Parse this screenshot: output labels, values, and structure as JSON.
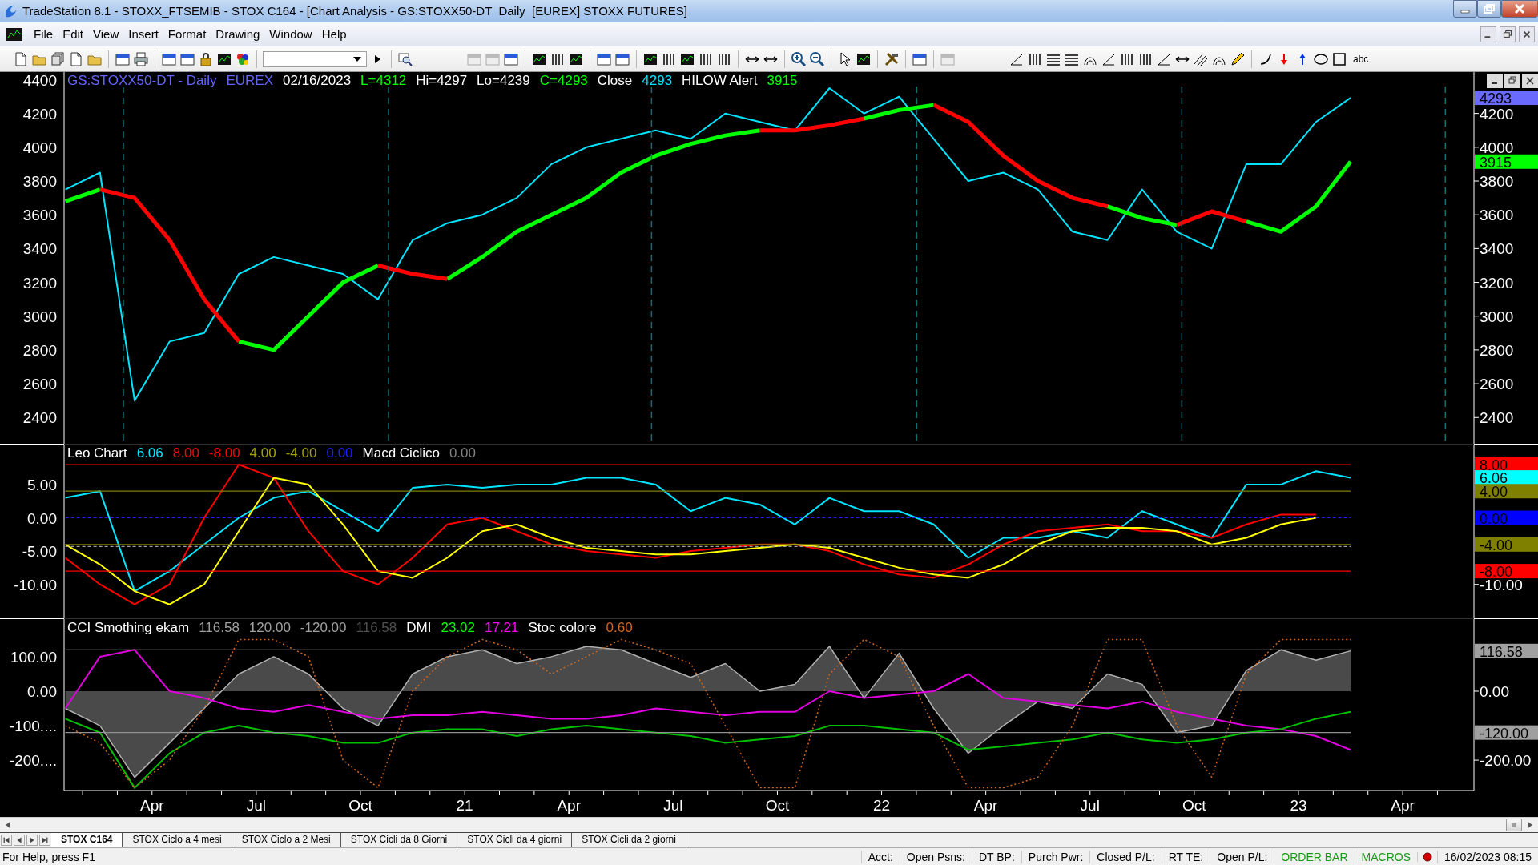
{
  "window": {
    "title": "TradeStation 8.1 - STOXX_FTSEMIB - STOX C164 - [Chart Analysis - GS:STOXX50-DT  Daily  [EUREX] STOXX FUTURES]"
  },
  "menu": [
    "File",
    "Edit",
    "View",
    "Insert",
    "Format",
    "Drawing",
    "Window",
    "Help"
  ],
  "toolbar": {
    "text_tool": "abc"
  },
  "panels": [
    {
      "legend": [
        {
          "text": "GS:STOXX50-DT - Daily",
          "color": "#6464ff"
        },
        {
          "text": "EUREX",
          "color": "#6464ff"
        },
        {
          "text": "02/16/2023",
          "color": "#ffffff"
        },
        {
          "text": "L=4312",
          "color": "#00ff00"
        },
        {
          "text": "Hi=4297",
          "color": "#ffffff"
        },
        {
          "text": "Lo=4239",
          "color": "#ffffff"
        },
        {
          "text": "C=4293",
          "color": "#00ff00"
        },
        {
          "text": "Close",
          "color": "#ffffff"
        },
        {
          "text": "4293",
          "color": "#00e5ff"
        },
        {
          "text": "HILOW Alert",
          "color": "#ffffff"
        },
        {
          "text": "3915",
          "color": "#00ff00"
        }
      ],
      "right_axis_labels": [
        "4200",
        "4000",
        "3800",
        "3600",
        "3400",
        "3200",
        "3000",
        "2800",
        "2600",
        "2400"
      ],
      "value_markers": [
        {
          "text": "4293",
          "color": "#6a6aff"
        },
        {
          "text": "3915",
          "color": "#00ff00"
        }
      ],
      "chart_data": {
        "type": "line",
        "x": [
          20.042,
          20.125,
          20.208,
          20.292,
          20.375,
          20.458,
          20.542,
          20.625,
          20.708,
          20.792,
          20.875,
          20.958,
          21.042,
          21.125,
          21.208,
          21.292,
          21.375,
          21.458,
          21.542,
          21.625,
          21.708,
          21.792,
          21.875,
          21.958,
          22.042,
          22.125,
          22.208,
          22.292,
          22.375,
          22.458,
          22.542,
          22.625,
          22.708,
          22.792,
          22.875,
          22.958,
          23.042,
          23.125
        ],
        "xlim": [
          20.039,
          23.417
        ],
        "ylim": [
          2240,
          4445
        ],
        "yticks": [
          {
            "value": 4400,
            "label": "4400"
          },
          {
            "value": 4200,
            "label": "4200"
          },
          {
            "value": 4000,
            "label": "4000"
          },
          {
            "value": 3800,
            "label": "3800"
          },
          {
            "value": 3600,
            "label": "3600"
          },
          {
            "value": 3400,
            "label": "3400"
          },
          {
            "value": 3200,
            "label": "3200"
          },
          {
            "value": 3000,
            "label": "3000"
          },
          {
            "value": 2800,
            "label": "2800"
          },
          {
            "value": 2600,
            "label": "2600"
          },
          {
            "value": 2400,
            "label": "2400"
          }
        ],
        "series": [
          {
            "color": "#00e5ff",
            "values": [
              3750,
              3850,
              2500,
              2850,
              2900,
              3250,
              3350,
              3300,
              3250,
              3100,
              3450,
              3550,
              3600,
              3700,
              3900,
              4000,
              4050,
              4100,
              4050,
              4200,
              4150,
              4100,
              4350,
              4200,
              4300,
              4050,
              3800,
              3850,
              3750,
              3500,
              3450,
              3750,
              3500,
              3400,
              3900,
              3900,
              4150,
              4293
            ]
          },
          {
            "color": "#00ff00",
            "values": [
              3680,
              3750,
              null,
              null,
              null,
              2850,
              2800,
              3000,
              3200,
              3300,
              null,
              3220,
              3350,
              3500,
              3600,
              3700,
              3850,
              3950,
              4020,
              4070,
              4100,
              null,
              null,
              4170,
              4220,
              4250,
              null,
              null,
              null,
              null,
              3650,
              3580,
              3540,
              null,
              3560,
              3500,
              3650,
              3915
            ]
          },
          {
            "color": "#ff0000",
            "values": [
              null,
              3750,
              3700,
              3450,
              3100,
              2850,
              null,
              null,
              null,
              3300,
              3250,
              3220,
              null,
              null,
              null,
              null,
              null,
              null,
              null,
              null,
              4100,
              4100,
              4130,
              4170,
              null,
              4250,
              4150,
              3950,
              3800,
              3700,
              3650,
              null,
              3540,
              3620,
              3560,
              null,
              null,
              null
            ]
          }
        ]
      }
    },
    {
      "legend": [
        {
          "text": "Leo Chart",
          "color": "#ffffff"
        },
        {
          "text": "6.06",
          "color": "#00e5ff"
        },
        {
          "text": "8.00",
          "color": "#ff0000"
        },
        {
          "text": "-8.00",
          "color": "#ff0000"
        },
        {
          "text": "4.00",
          "color": "#a0a000"
        },
        {
          "text": "-4.00",
          "color": "#a0a000"
        },
        {
          "text": "0.00",
          "color": "#2020ff"
        },
        {
          "text": "Macd Ciclico",
          "color": "#ffffff"
        },
        {
          "text": "0.00",
          "color": "#808080"
        }
      ],
      "right_axis_labels": [
        "-10.00"
      ],
      "value_markers": [
        {
          "text": "8.00",
          "color": "#ff0000"
        },
        {
          "text": "6.06",
          "color": "#00ffff"
        },
        {
          "text": "4.00",
          "color": "#808000"
        },
        {
          "text": "0.00",
          "color": "#0000ff"
        },
        {
          "text": "-4.00",
          "color": "#808000"
        },
        {
          "text": "-8.00",
          "color": "#ff0000"
        }
      ],
      "chart_data": {
        "type": "line",
        "x": [
          20.042,
          20.125,
          20.208,
          20.292,
          20.375,
          20.458,
          20.542,
          20.625,
          20.708,
          20.792,
          20.875,
          20.958,
          21.042,
          21.125,
          21.208,
          21.292,
          21.375,
          21.458,
          21.542,
          21.625,
          21.708,
          21.792,
          21.875,
          21.958,
          22.042,
          22.125,
          22.208,
          22.292,
          22.375,
          22.458,
          22.542,
          22.625,
          22.708,
          22.792,
          22.875,
          22.958,
          23.042,
          23.125
        ],
        "xlim": [
          20.039,
          23.417
        ],
        "ylim": [
          -15.2,
          11
        ],
        "yticks": [
          {
            "value": 5,
            "label": "5.00"
          },
          {
            "value": 0,
            "label": "0.00"
          },
          {
            "value": -5,
            "label": "-5.00"
          },
          {
            "value": -10,
            "label": "-10.00"
          }
        ],
        "series": [
          {
            "color": "#00e5ff",
            "values": [
              3,
              4,
              -11,
              -8,
              -4,
              0,
              3,
              4,
              1,
              -2,
              4.5,
              5,
              4.5,
              5,
              5,
              6,
              6,
              5,
              1,
              3,
              2,
              -1,
              3,
              1,
              1,
              -1,
              -6,
              -3,
              -3,
              -2,
              -3,
              1,
              -1,
              -3,
              5,
              5,
              7,
              6
            ]
          },
          {
            "color": "#ff0000",
            "values": [
              -6,
              -10,
              -13,
              -10,
              0,
              8,
              6,
              -2,
              -8,
              -10,
              -6,
              -1,
              0,
              -2,
              -4,
              -5,
              -5.5,
              -6,
              -5,
              -4.5,
              -4,
              -4,
              -5,
              -7,
              -8.5,
              -9,
              -7,
              -4,
              -2,
              -1.5,
              -1,
              -2,
              -2,
              -3,
              -1,
              0.5,
              0.5,
              null
            ]
          },
          {
            "color": "#ffff00",
            "values": [
              -4,
              -7,
              -11,
              -13,
              -10,
              -2,
              6,
              5,
              -1,
              -8,
              -9,
              -6,
              -2,
              -1,
              -3,
              -4.5,
              -5,
              -5.5,
              -5.5,
              -5,
              -4.5,
              -4,
              -4.5,
              -6,
              -7.5,
              -8.5,
              -9,
              -7,
              -4,
              -2,
              -1.5,
              -1.5,
              -2,
              -4,
              -3,
              -1,
              0,
              null
            ]
          },
          {
            "color": "#ff0000",
            "values": [
              8,
              8,
              8,
              8,
              8,
              8,
              8,
              8,
              8,
              8,
              8,
              8,
              8,
              8,
              8,
              8,
              8,
              8,
              8,
              8,
              8,
              8,
              8,
              8,
              8,
              8,
              8,
              8,
              8,
              8,
              8,
              8,
              8,
              8,
              8,
              8,
              8,
              8
            ]
          },
          {
            "color": "#ff0000",
            "values": [
              -8,
              -8,
              -8,
              -8,
              -8,
              -8,
              -8,
              -8,
              -8,
              -8,
              -8,
              -8,
              -8,
              -8,
              -8,
              -8,
              -8,
              -8,
              -8,
              -8,
              -8,
              -8,
              -8,
              -8,
              -8,
              -8,
              -8,
              -8,
              -8,
              -8,
              -8,
              -8,
              -8,
              -8,
              -8,
              -8,
              -8,
              -8
            ]
          },
          {
            "color": "#808000",
            "values": [
              4,
              4,
              4,
              4,
              4,
              4,
              4,
              4,
              4,
              4,
              4,
              4,
              4,
              4,
              4,
              4,
              4,
              4,
              4,
              4,
              4,
              4,
              4,
              4,
              4,
              4,
              4,
              4,
              4,
              4,
              4,
              4,
              4,
              4,
              4,
              4,
              4,
              4
            ]
          },
          {
            "color": "#808000",
            "values": [
              -4,
              -4,
              -4,
              -4,
              -4,
              -4,
              -4,
              -4,
              -4,
              -4,
              -4,
              -4,
              -4,
              -4,
              -4,
              -4,
              -4,
              -4,
              -4,
              -4,
              -4,
              -4,
              -4,
              -4,
              -4,
              -4,
              -4,
              -4,
              -4,
              -4,
              -4,
              -4,
              -4,
              -4,
              -4,
              -4,
              -4,
              -4
            ]
          },
          {
            "color": "#2020ff",
            "line_style": "dashed",
            "values": [
              0,
              0,
              0,
              0,
              0,
              0,
              0,
              0,
              0,
              0,
              0,
              0,
              0,
              0,
              0,
              0,
              0,
              0,
              0,
              0,
              0,
              0,
              0,
              0,
              0,
              0,
              0,
              0,
              0,
              0,
              0,
              0,
              0,
              0,
              0,
              0,
              0,
              0
            ]
          },
          {
            "color": "#a0a0a0",
            "line_style": "dashed",
            "values": [
              -4.3,
              -4.3,
              -4.3,
              -4.3,
              -4.3,
              -4.3,
              -4.3,
              -4.3,
              -4.3,
              -4.3,
              -4.3,
              -4.3,
              -4.3,
              -4.3,
              -4.3,
              -4.3,
              -4.3,
              -4.3,
              -4.3,
              -4.3,
              -4.3,
              -4.3,
              -4.3,
              -4.3,
              -4.3,
              -4.3,
              -4.3,
              -4.3,
              -4.3,
              -4.3,
              -4.3,
              -4.3,
              -4.3,
              -4.3,
              -4.3,
              -4.3,
              -4.3,
              -4.3
            ]
          }
        ]
      }
    },
    {
      "legend": [
        {
          "text": "CCI Smothing ekam",
          "color": "#ffffff"
        },
        {
          "text": "116.58",
          "color": "#a0a0a0"
        },
        {
          "text": "120.00",
          "color": "#a0a0a0"
        },
        {
          "text": "-120.00",
          "color": "#a0a0a0"
        },
        {
          "text": "116.58",
          "color": "#505050"
        },
        {
          "text": "DMI",
          "color": "#ffffff"
        },
        {
          "text": "23.02",
          "color": "#00ff00"
        },
        {
          "text": "17.21",
          "color": "#ff00ff"
        },
        {
          "text": "Stoc colore",
          "color": "#ffffff"
        },
        {
          "text": "0.60",
          "color": "#d2691e"
        }
      ],
      "right_axis_labels": [
        "0.00",
        "-200.00"
      ],
      "value_markers": [
        {
          "text": "116.58",
          "color": "#a0a0a0"
        },
        {
          "text": "-120.00",
          "color": "#a0a0a0"
        }
      ],
      "chart_data": {
        "type": "line",
        "x": [
          20.042,
          20.125,
          20.208,
          20.292,
          20.375,
          20.458,
          20.542,
          20.625,
          20.708,
          20.792,
          20.875,
          20.958,
          21.042,
          21.125,
          21.208,
          21.292,
          21.375,
          21.458,
          21.542,
          21.625,
          21.708,
          21.792,
          21.875,
          21.958,
          22.042,
          22.125,
          22.208,
          22.292,
          22.375,
          22.458,
          22.542,
          22.625,
          22.708,
          22.792,
          22.875,
          22.958,
          23.042,
          23.125
        ],
        "xlim": [
          20.039,
          23.417
        ],
        "ylim": [
          -288,
          209
        ],
        "xticks": [
          {
            "value": 20.25,
            "label": "Apr"
          },
          {
            "value": 20.5,
            "label": "Jul"
          },
          {
            "value": 20.75,
            "label": "Oct"
          },
          {
            "value": 21,
            "label": "21"
          },
          {
            "value": 21.25,
            "label": "Apr"
          },
          {
            "value": 21.5,
            "label": "Jul"
          },
          {
            "value": 21.75,
            "label": "Oct"
          },
          {
            "value": 22,
            "label": "22"
          },
          {
            "value": 22.25,
            "label": "Apr"
          },
          {
            "value": 22.5,
            "label": "Jul"
          },
          {
            "value": 22.75,
            "label": "Oct"
          },
          {
            "value": 23,
            "label": "23"
          },
          {
            "value": 23.25,
            "label": "Apr"
          }
        ],
        "yticks": [
          {
            "value": 100,
            "label": "100.00"
          },
          {
            "value": 0,
            "label": "0.00"
          },
          {
            "value": -100,
            "label": "-100...."
          },
          {
            "value": -200,
            "label": "-200...."
          }
        ],
        "series": [
          {
            "color": "#b0b0b0",
            "values": [
              -50,
              -100,
              -250,
              -150,
              -50,
              50,
              100,
              50,
              -50,
              -100,
              50,
              100,
              120,
              80,
              100,
              130,
              120,
              80,
              40,
              80,
              0,
              20,
              130,
              -20,
              110,
              -50,
              -180,
              -100,
              -30,
              -50,
              50,
              20,
              -120,
              -100,
              60,
              120,
              90,
              117
            ]
          },
          {
            "color": "#e000e0",
            "values": [
              -50,
              100,
              120,
              0,
              -20,
              -50,
              -60,
              -40,
              -60,
              -80,
              -70,
              -70,
              -60,
              -70,
              -80,
              -80,
              -70,
              -50,
              -60,
              -70,
              -60,
              -60,
              0,
              -20,
              -10,
              0,
              50,
              -20,
              -30,
              -40,
              -50,
              -30,
              -60,
              -80,
              -100,
              -110,
              -130,
              -170
            ]
          },
          {
            "color": "#00c000",
            "values": [
              -80,
              -120,
              -280,
              -180,
              -120,
              -100,
              -120,
              -130,
              -150,
              -150,
              -120,
              -110,
              -110,
              -130,
              -110,
              -100,
              -110,
              -120,
              -130,
              -150,
              -140,
              -130,
              -100,
              -100,
              -110,
              -120,
              -170,
              -160,
              -150,
              -140,
              -120,
              -140,
              -150,
              -140,
              -120,
              -110,
              -80,
              -60
            ]
          },
          {
            "color": "#d2691e",
            "line_style": "dotted",
            "values": [
              -100,
              -150,
              -280,
              -200,
              -50,
              150,
              150,
              100,
              -200,
              -280,
              0,
              100,
              150,
              120,
              50,
              100,
              150,
              120,
              80,
              -100,
              -280,
              -280,
              50,
              150,
              100,
              -100,
              -280,
              -280,
              -250,
              -100,
              150,
              150,
              -100,
              -250,
              50,
              150,
              150,
              150
            ]
          },
          {
            "color": "#909090",
            "values": [
              120,
              120,
              120,
              120,
              120,
              120,
              120,
              120,
              120,
              120,
              120,
              120,
              120,
              120,
              120,
              120,
              120,
              120,
              120,
              120,
              120,
              120,
              120,
              120,
              120,
              120,
              120,
              120,
              120,
              120,
              120,
              120,
              120,
              120,
              120,
              120,
              120,
              120
            ]
          },
          {
            "color": "#909090",
            "values": [
              -120,
              -120,
              -120,
              -120,
              -120,
              -120,
              -120,
              -120,
              -120,
              -120,
              -120,
              -120,
              -120,
              -120,
              -120,
              -120,
              -120,
              -120,
              -120,
              -120,
              -120,
              -120,
              -120,
              -120,
              -120,
              -120,
              -120,
              -120,
              -120,
              -120,
              -120,
              -120,
              -120,
              -120,
              -120,
              -120,
              -120,
              -120
            ]
          }
        ]
      }
    }
  ],
  "sheet_tabs": [
    {
      "label": "STOX C164",
      "selected": true
    },
    {
      "label": "STOX Ciclo a 4 mesi",
      "selected": false
    },
    {
      "label": "STOX Ciclo a 2 Mesi",
      "selected": false
    },
    {
      "label": "STOX Cicli da 8 Giorni",
      "selected": false
    },
    {
      "label": "STOX Cicli da 4 giorni",
      "selected": false
    },
    {
      "label": "STOX Cicli da 2 giorni",
      "selected": false
    }
  ],
  "status_bar": {
    "help": "For Help, press F1",
    "fields": [
      {
        "text": "Acct:",
        "color": "#000000"
      },
      {
        "text": "Open Psns:",
        "color": "#000000"
      },
      {
        "text": "DT BP:",
        "color": "#000000"
      },
      {
        "text": "Purch Pwr:",
        "color": "#000000"
      },
      {
        "text": "Closed P/L:",
        "color": "#000000"
      },
      {
        "text": "RT TE:",
        "color": "#000000"
      },
      {
        "text": "Open P/L:",
        "color": "#000000"
      },
      {
        "text": "ORDER BAR",
        "color": "#1a9a1a"
      },
      {
        "text": "MACROS",
        "color": "#1a9a1a"
      }
    ],
    "clock": "16/02/2023 08:15"
  }
}
